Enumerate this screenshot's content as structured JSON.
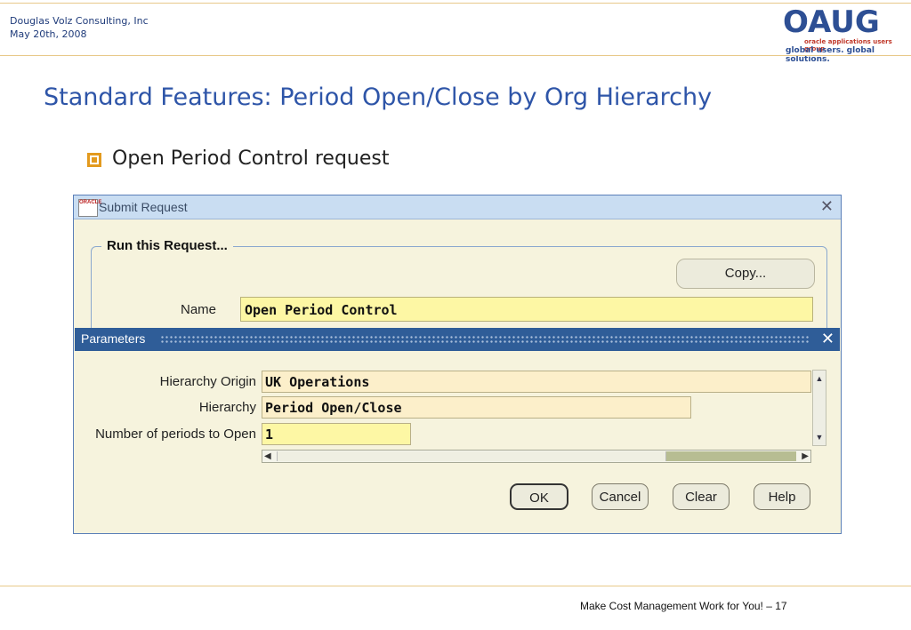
{
  "slide": {
    "company": "Douglas Volz Consulting, Inc",
    "date": "May 20th, 2008",
    "logo_text": "OAUG",
    "logo_subtext": "oracle applications users group",
    "logo_tagline": "global users. global solutions.",
    "title": "Standard Features:  Period Open/Close by Org Hierarchy",
    "bullet": "Open Period Control request",
    "footer": "Make Cost Management Work for You! – 17"
  },
  "submit_window": {
    "title": "Submit Request",
    "app_icon_text": "ORACLE",
    "frame_label": "Run this Request...",
    "copy_label": "Copy...",
    "name_label": "Name",
    "name_value": "Open Period Control"
  },
  "params_dialog": {
    "title": "Parameters",
    "fields": [
      {
        "label": "Hierarchy Origin",
        "value": "UK Operations"
      },
      {
        "label": "Hierarchy",
        "value": "Period Open/Close"
      },
      {
        "label": "Number of periods to Open",
        "value": "1"
      }
    ],
    "buttons": {
      "ok": "OK",
      "cancel": "Cancel",
      "clear": "Clear",
      "help": "Help"
    }
  },
  "colors": {
    "title_blue": "#2e55a8",
    "accent_orange": "#e39a1e",
    "dialog_titlebar": "#2f5d98",
    "required_field": "#fdf7a4"
  },
  "icons": [
    "close-icon",
    "scroll-up-icon",
    "scroll-down-icon",
    "scroll-left-icon",
    "scroll-right-icon",
    "bullet-square-icon",
    "oracle-app-icon"
  ]
}
